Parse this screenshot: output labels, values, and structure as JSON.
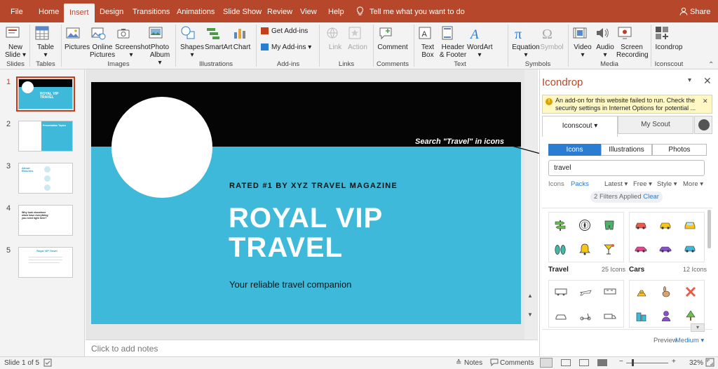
{
  "menu": {
    "tabs": [
      "File",
      "Home",
      "Insert",
      "Design",
      "Transitions",
      "Animations",
      "Slide Show",
      "Review",
      "View",
      "Help"
    ],
    "active_tab": "Insert",
    "tell_me": "Tell me what you want to do",
    "share": "Share"
  },
  "ribbon": {
    "groups": {
      "slides": "Slides",
      "tables": "Tables",
      "images": "Images",
      "illustrations": "Illustrations",
      "addins": "Add-ins",
      "links": "Links",
      "comments": "Comments",
      "text": "Text",
      "symbols": "Symbols",
      "media": "Media",
      "iconscout": "Iconscout"
    },
    "buttons": {
      "new_slide_1": "New",
      "new_slide_2": "Slide",
      "table_1": "Table",
      "pictures_1": "Pictures",
      "online_pictures_1": "Online",
      "online_pictures_2": "Pictures",
      "screenshot_1": "Screenshot",
      "photo_album_1": "Photo",
      "photo_album_2": "Album",
      "shapes_1": "Shapes",
      "smartart_1": "SmartArt",
      "chart_1": "Chart",
      "get_addins": "Get Add-ins",
      "my_addins": "My Add-ins",
      "link_1": "Link",
      "action_1": "Action",
      "comment_1": "Comment",
      "text_box_1": "Text",
      "text_box_2": "Box",
      "header_footer_1": "Header",
      "header_footer_2": "& Footer",
      "wordart_1": "WordArt",
      "equation_1": "Equation",
      "symbol_1": "Symbol",
      "video_1": "Video",
      "audio_1": "Audio",
      "screen_rec_1": "Screen",
      "screen_rec_2": "Recording",
      "icondrop_1": "Icondrop"
    }
  },
  "thumbnails": {
    "numbers": [
      "1",
      "2",
      "3",
      "4",
      "5"
    ],
    "t1_title": "ROYAL VIP TRAVEL",
    "t2_title": "Presentation Topics",
    "t3_title": "About Beaches",
    "t4_title": "Why look elsewhere when have everything you need right here?",
    "t5_title": "Royal VIP Travel"
  },
  "slide": {
    "kicker": "RATED #1 BY XYZ TRAVEL MAGAZINE",
    "title_line1": "ROYAL VIP",
    "title_line2": "TRAVEL",
    "subtitle": "Your reliable travel companion"
  },
  "annotation": "Search \"Travel\" in icons",
  "notes_placeholder": "Click to add notes",
  "pane": {
    "title": "Icondrop",
    "warning": "An add-on for this website failed to run. Check the security settings in Internet Options for potential ...",
    "tab_iconscout": "Iconscout ▾",
    "tab_myscout": "My Scout",
    "seg": [
      "Icons",
      "Illustrations",
      "Photos"
    ],
    "search_value": "travel",
    "filter_icons": "Icons",
    "filter_packs": "Packs",
    "dropdowns": [
      "Latest ▾",
      "Free ▾",
      "Style ▾",
      "More ▾"
    ],
    "filters_applied": "2 Filters Applied",
    "clear": "Clear",
    "pack1_name": "Travel",
    "pack1_count": "25 Icons",
    "pack2_name": "Cars",
    "pack2_count": "12 Icons",
    "preview_label": "Preview",
    "preview_value": "Medium ▾"
  },
  "status": {
    "slide_of": "Slide 1 of 5",
    "notes": "Notes",
    "comments": "Comments",
    "zoom": "32%"
  },
  "colors": {
    "accent": "#b7472a",
    "slide_bg": "#3fb9d9",
    "slide_top": "#050505",
    "pane_blue": "#2b7cd3"
  }
}
